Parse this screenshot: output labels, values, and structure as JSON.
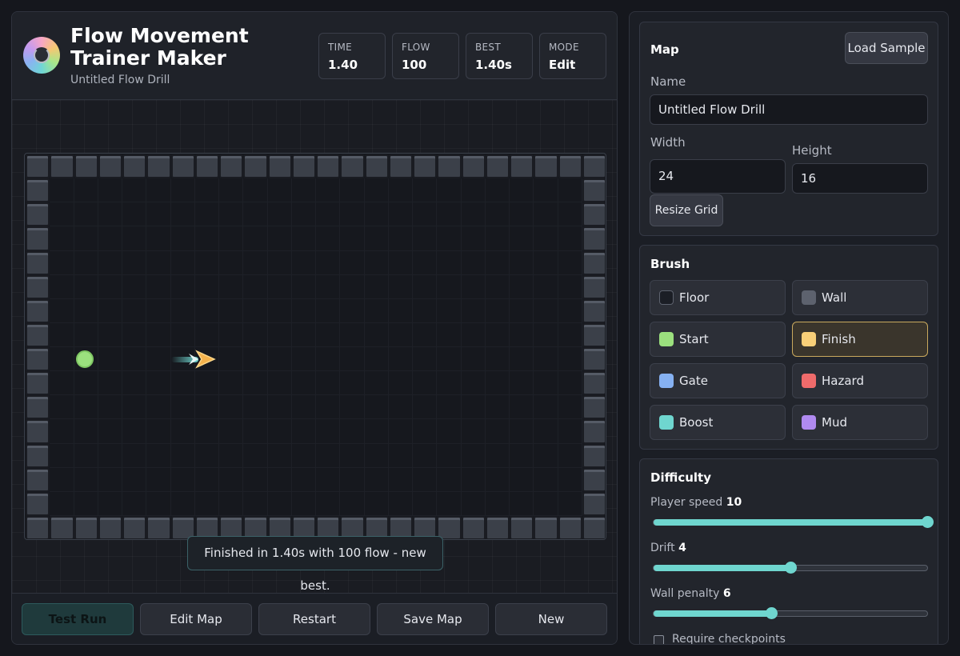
{
  "app": {
    "title": "Flow Movement Trainer Maker",
    "subtitle": "Untitled Flow Drill"
  },
  "stats": [
    {
      "label": "TIME",
      "value": "1.40"
    },
    {
      "label": "FLOW",
      "value": "100"
    },
    {
      "label": "BEST",
      "value": "1.40s"
    },
    {
      "label": "MODE",
      "value": "Edit"
    }
  ],
  "board": {
    "cols": 24,
    "rows": 16,
    "toast": "Finished in 1.40s with 100 flow - new best."
  },
  "footer": {
    "buttons": [
      "Test Run",
      "Edit Map",
      "Restart",
      "Save Map",
      "New"
    ]
  },
  "map": {
    "title": "Map",
    "load_sample": "Load Sample",
    "name_label": "Name",
    "name_value": "Untitled Flow Drill",
    "width_label": "Width",
    "width_value": "24",
    "height_label": "Height",
    "height_value": "16",
    "resize": "Resize Grid"
  },
  "brush": {
    "title": "Brush",
    "selected": "Finish",
    "items": [
      {
        "label": "Floor",
        "color": "#1b1e25"
      },
      {
        "label": "Wall",
        "color": "#5d626e"
      },
      {
        "label": "Start",
        "color": "#9be07e"
      },
      {
        "label": "Finish",
        "color": "#f8cf78"
      },
      {
        "label": "Gate",
        "color": "#86b1f2"
      },
      {
        "label": "Hazard",
        "color": "#ef6b6b"
      },
      {
        "label": "Boost",
        "color": "#6fd6cf"
      },
      {
        "label": "Mud",
        "color": "#b08af0"
      }
    ]
  },
  "difficulty": {
    "title": "Difficulty",
    "sliders": [
      {
        "label": "Player speed",
        "value": 10,
        "fraction": 1.0
      },
      {
        "label": "Drift",
        "value": 4,
        "fraction": 0.5
      },
      {
        "label": "Wall penalty",
        "value": 6,
        "fraction": 0.43
      }
    ],
    "checkbox_label": "Require checkpoints"
  },
  "colors": {
    "accent": "#6fd6cf",
    "highlight": "#c9a95e"
  }
}
